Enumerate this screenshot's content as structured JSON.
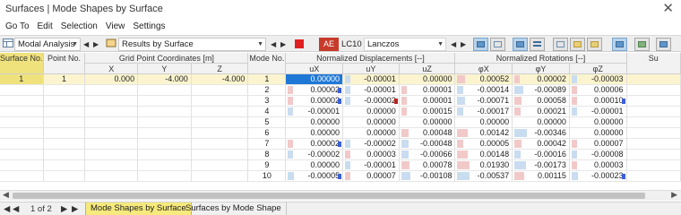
{
  "window": {
    "title": "Surfaces | Mode Shapes by Surface",
    "close_glyph": "✕"
  },
  "menu": [
    "Go To",
    "Edit",
    "Selection",
    "View",
    "Settings"
  ],
  "toolbar": {
    "analysis": "Modal Analysis",
    "results": "Results by Surface",
    "lc_badge": "AE",
    "lc_label": "LC10",
    "solver": "Lanczos",
    "colors": {
      "lc_swatch": "#e02020",
      "badge": "#c83a2a"
    }
  },
  "headers": {
    "surface_no": "Surface No.",
    "point_no": "Point No.",
    "grid_coords": "Grid Point Coordinates [m]",
    "x": "X",
    "y": "Y",
    "z": "Z",
    "mode_no": "Mode No.",
    "norm_disp": "Normalized Displacements [--]",
    "ux": "uX",
    "uy": "uY",
    "uz": "uZ",
    "norm_rot": "Normalized Rotations [--]",
    "phix": "φX",
    "phiy": "φY",
    "phiz": "φZ",
    "sum": "Su"
  },
  "first_row": {
    "surface": "1",
    "point": "1",
    "x": "0.000",
    "y": "-4.000",
    "z": "-4.000"
  },
  "rows": [
    {
      "mode": "1",
      "ux": "0.00000",
      "uy": "-0.00001",
      "uz": "0.00000",
      "phix": "0.00052",
      "phiy": "0.00002",
      "phiz": "-0.00003"
    },
    {
      "mode": "2",
      "ux": "0.00002",
      "uy": "-0.00001",
      "uz": "0.00001",
      "phix": "-0.00014",
      "phiy": "-0.00089",
      "phiz": "0.00006"
    },
    {
      "mode": "3",
      "ux": "0.00002",
      "uy": "-0.00002",
      "uz": "0.00001",
      "phix": "-0.00071",
      "phiy": "0.00058",
      "phiz": "0.00010"
    },
    {
      "mode": "4",
      "ux": "-0.00001",
      "uy": "0.00000",
      "uz": "0.00015",
      "phix": "-0.00017",
      "phiy": "0.00021",
      "phiz": "-0.00001"
    },
    {
      "mode": "5",
      "ux": "0.00000",
      "uy": "0.00000",
      "uz": "0.00000",
      "phix": "0.00000",
      "phiy": "0.00000",
      "phiz": "0.00000"
    },
    {
      "mode": "6",
      "ux": "0.00000",
      "uy": "0.00000",
      "uz": "0.00048",
      "phix": "0.00142",
      "phiy": "-0.00346",
      "phiz": "0.00000"
    },
    {
      "mode": "7",
      "ux": "0.00002",
      "uy": "-0.00002",
      "uz": "-0.00048",
      "phix": "0.00005",
      "phiy": "0.00042",
      "phiz": "0.00007"
    },
    {
      "mode": "8",
      "ux": "-0.00002",
      "uy": "0.00003",
      "uz": "-0.00066",
      "phix": "0.00148",
      "phiy": "-0.00016",
      "phiz": "-0.00008"
    },
    {
      "mode": "9",
      "ux": "0.00000",
      "uy": "-0.00001",
      "uz": "0.00078",
      "phix": "0.01930",
      "phiy": "-0.00173",
      "phiz": "0.00003"
    },
    {
      "mode": "10",
      "ux": "-0.00005",
      "uy": "0.00007",
      "uz": "-0.00108",
      "phix": "-0.00537",
      "phiy": "0.00115",
      "phiz": "-0.00023"
    }
  ],
  "status": {
    "page": "1 of 2",
    "tabs": [
      "Mode Shapes by Surface",
      "Surfaces by Mode Shape"
    ]
  }
}
